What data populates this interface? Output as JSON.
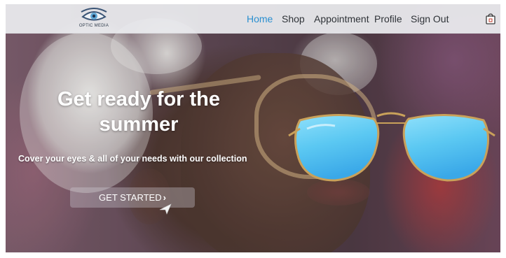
{
  "brand": {
    "name": "OPTIC MEDIA",
    "logo_icon": "eye-icon",
    "accent": "#2a8fd0"
  },
  "nav": {
    "items": [
      {
        "label": "Home",
        "active": true
      },
      {
        "label": "Shop",
        "active": false
      },
      {
        "label": "Appointment",
        "active": false
      },
      {
        "label": "Profile",
        "active": false
      },
      {
        "label": "Sign Out",
        "active": false
      }
    ],
    "cart_icon": "shopping-bag-icon"
  },
  "hero": {
    "title_line1": "Get ready for the",
    "title_line2": "summer",
    "subtitle": "Cover your eyes & all of your needs with our collection",
    "cta_label": "GET STARTED",
    "cta_icon": "chevron-right-icon",
    "lens_color": "#5bc8f2",
    "frame_color": "#c9a15a"
  }
}
